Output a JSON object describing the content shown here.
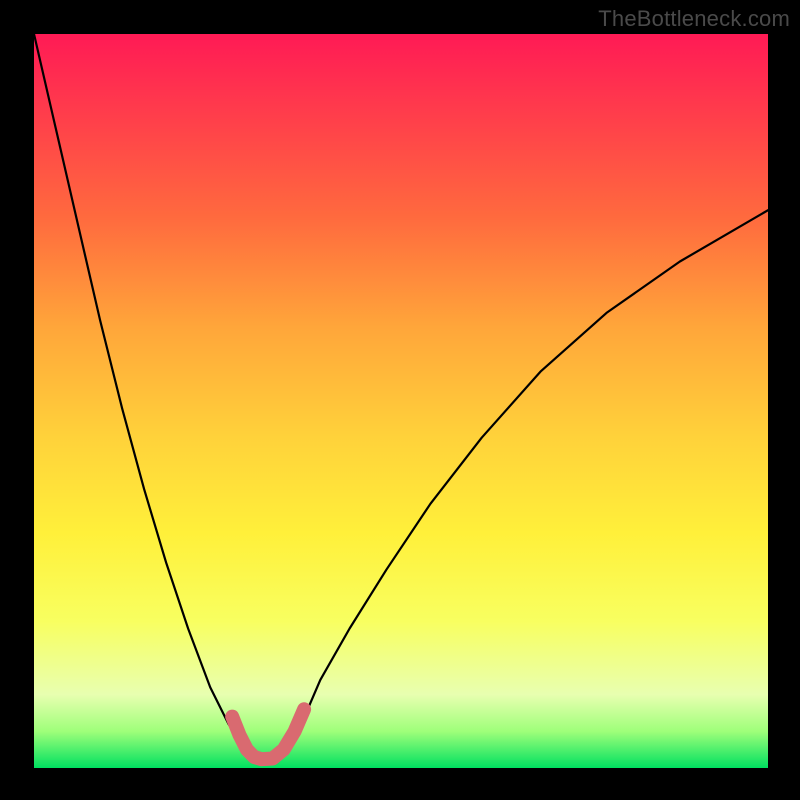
{
  "watermark": "TheBottleneck.com",
  "chart_data": {
    "type": "line",
    "title": "",
    "xlabel": "",
    "ylabel": "",
    "xlim": [
      0,
      1
    ],
    "ylim": [
      0,
      1
    ],
    "series": [
      {
        "name": "main-curve",
        "x": [
          0.0,
          0.03,
          0.06,
          0.09,
          0.12,
          0.15,
          0.18,
          0.21,
          0.24,
          0.265,
          0.285,
          0.3,
          0.317,
          0.333,
          0.36,
          0.39,
          0.43,
          0.48,
          0.54,
          0.61,
          0.69,
          0.78,
          0.88,
          1.0
        ],
        "y": [
          1.0,
          0.87,
          0.74,
          0.61,
          0.49,
          0.38,
          0.28,
          0.19,
          0.11,
          0.06,
          0.03,
          0.018,
          0.01,
          0.018,
          0.05,
          0.12,
          0.19,
          0.27,
          0.36,
          0.45,
          0.54,
          0.62,
          0.69,
          0.76
        ]
      },
      {
        "name": "highlight-segment",
        "x": [
          0.27,
          0.28,
          0.29,
          0.3,
          0.31,
          0.325,
          0.34,
          0.355,
          0.368
        ],
        "y": [
          0.07,
          0.045,
          0.025,
          0.015,
          0.012,
          0.013,
          0.025,
          0.05,
          0.08
        ]
      }
    ],
    "background_gradient": {
      "top_color": "#ff1a55",
      "mid_color": "#ffd23a",
      "bottom_color": "#00e060"
    },
    "highlight_color": "#d96a70",
    "curve_color": "#000000"
  }
}
